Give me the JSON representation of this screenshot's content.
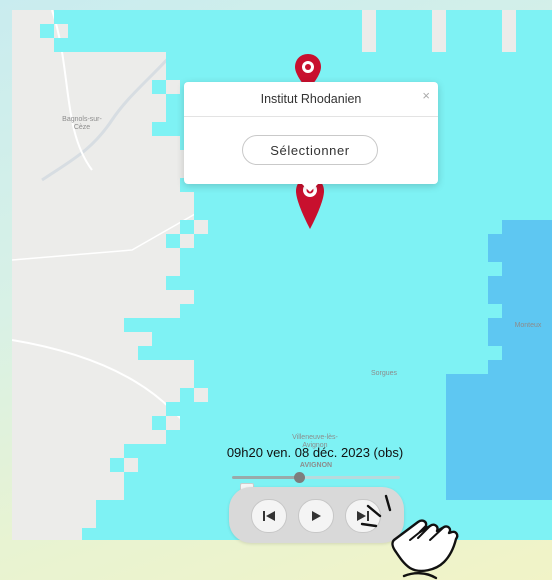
{
  "map": {
    "towns": [
      {
        "name": "Bagnols-sur-Cèze"
      },
      {
        "name": "Sorgues"
      },
      {
        "name": "Villeneuve-lès-Avignon"
      },
      {
        "name": "AVIGNON"
      },
      {
        "name": "Monteux"
      }
    ],
    "colors": {
      "radar_light": "#7ef2f4",
      "radar_blue": "#5ec7f2",
      "pin": "#c8102e"
    }
  },
  "popup": {
    "title": "Institut Rhodanien",
    "close_label": "×",
    "select_label": "Sélectionner"
  },
  "timeline": {
    "timestamp": "09h20 ven. 08 déc. 2023 (obs)",
    "position_fraction": 0.4
  },
  "controls": {
    "previous_icon": "skip-back-icon",
    "play_icon": "play-icon",
    "next_icon": "skip-forward-icon"
  }
}
